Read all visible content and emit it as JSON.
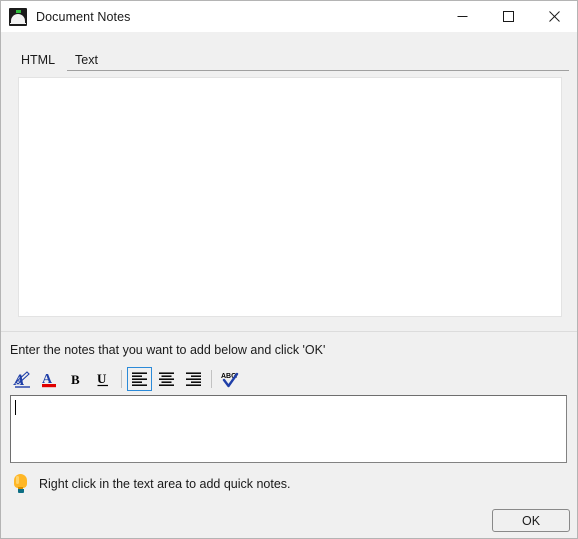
{
  "window": {
    "title": "Document Notes",
    "icon": "document-notes-app-icon",
    "controls": [
      {
        "name": "minimize-button",
        "glyph": "minimize-icon",
        "label": "Minimize"
      },
      {
        "name": "maximize-button",
        "glyph": "maximize-icon",
        "label": "Maximize"
      },
      {
        "name": "close-button",
        "glyph": "close-icon",
        "label": "Close"
      }
    ]
  },
  "tabs": [
    {
      "label": "HTML",
      "active": true
    },
    {
      "label": "Text",
      "active": false
    }
  ],
  "preview": {
    "content": ""
  },
  "instruction": "Enter the notes that you want to add below and click 'OK'",
  "toolbar": {
    "buttons": [
      {
        "name": "font-dialog-button",
        "icon": "font-a-pen-icon",
        "label": "Font",
        "selected": false
      },
      {
        "name": "font-color-button",
        "icon": "font-color-a-icon",
        "label": "Font Color",
        "selected": false
      },
      {
        "name": "bold-button",
        "icon": "bold-icon",
        "label": "B",
        "selected": false
      },
      {
        "name": "underline-button",
        "icon": "underline-icon",
        "label": "U",
        "selected": false
      },
      {
        "name": "align-left-button",
        "icon": "align-left-icon",
        "label": "Align Left",
        "selected": true
      },
      {
        "name": "align-center-button",
        "icon": "align-center-icon",
        "label": "Align Center",
        "selected": false
      },
      {
        "name": "align-right-button",
        "icon": "align-right-icon",
        "label": "Align Right",
        "selected": false
      },
      {
        "name": "spell-check-button",
        "icon": "spell-check-abc-icon",
        "label": "Spelling",
        "selected": false
      }
    ]
  },
  "notes_input": {
    "value": "",
    "placeholder": "",
    "caret_visible": true
  },
  "hint": {
    "icon": "lightbulb-icon",
    "text": "Right click in the text area to add quick notes."
  },
  "footer": {
    "ok_label": "OK"
  },
  "colors": {
    "window_background": "#f0f0f0",
    "titlebar_background": "#ffffff",
    "accent_selected": "#2b8ad8",
    "font_icon_blue": "#1f3fa8",
    "font_color_red": "#e00000",
    "bulb_amber": "#ffb726",
    "bulb_base_teal": "#0d6e84",
    "icon_green": "#2fbd3c",
    "text_primary": "#1a1a1a"
  }
}
